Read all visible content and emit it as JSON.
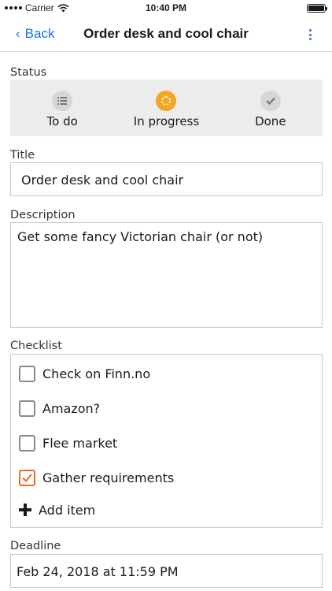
{
  "status_bar": {
    "carrier": "Carrier",
    "time": "10:40 PM"
  },
  "nav": {
    "back_label": "Back",
    "title": "Order desk and cool chair",
    "accent_color": "#1f73d6"
  },
  "status": {
    "label": "Status",
    "options": [
      {
        "label": "To do",
        "icon": "list-icon",
        "selected": false
      },
      {
        "label": "In progress",
        "icon": "progress-icon",
        "selected": true
      },
      {
        "label": "Done",
        "icon": "checkmark-icon",
        "selected": false
      }
    ],
    "active_color": "#f5a623"
  },
  "title_field": {
    "label": "Title",
    "value": "Order desk and cool chair"
  },
  "description_field": {
    "label": "Description",
    "value": "Get some fancy Victorian chair (or not)"
  },
  "checklist": {
    "label": "Checklist",
    "items": [
      {
        "text": "Check on Finn.no",
        "checked": false
      },
      {
        "text": "Amazon?",
        "checked": false
      },
      {
        "text": "Flee market",
        "checked": false
      },
      {
        "text": "Gather requirements",
        "checked": true
      }
    ],
    "add_item_label": "Add item",
    "checked_color": "#e0702a"
  },
  "deadline_field": {
    "label": "Deadline",
    "value": "Feb 24, 2018 at 11:59 PM"
  }
}
